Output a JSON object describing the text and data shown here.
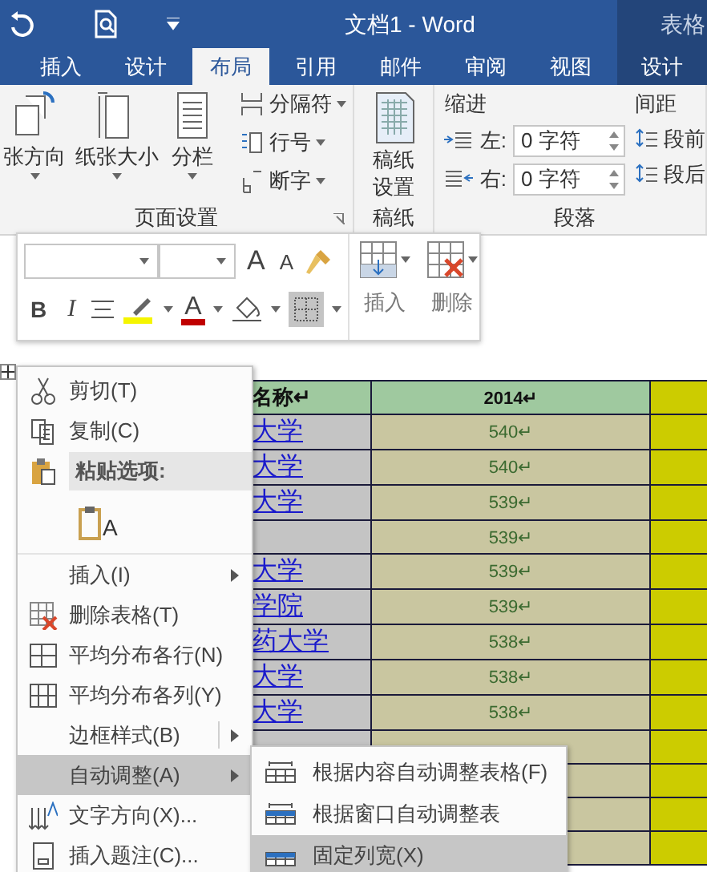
{
  "title_bar": {
    "title": "文档1 - Word",
    "context_group": "表格"
  },
  "tabs": [
    {
      "label": "插入",
      "selected": false,
      "kind": "normal"
    },
    {
      "label": "设计",
      "selected": false,
      "kind": "normal"
    },
    {
      "label": "布局",
      "selected": true,
      "kind": "normal"
    },
    {
      "label": "引用",
      "selected": false,
      "kind": "normal"
    },
    {
      "label": "邮件",
      "selected": false,
      "kind": "normal"
    },
    {
      "label": "审阅",
      "selected": false,
      "kind": "normal"
    },
    {
      "label": "视图",
      "selected": false,
      "kind": "normal"
    },
    {
      "label": "设计",
      "selected": false,
      "kind": "context"
    }
  ],
  "ribbon": {
    "page_setup": {
      "label": "页面设置",
      "large_buttons": [
        "张方向",
        "纸张大小",
        "分栏"
      ],
      "small_buttons": [
        "分隔符",
        "行号",
        "断字"
      ]
    },
    "manuscript": {
      "label": "稿纸",
      "button": "稿纸设置"
    },
    "paragraph": {
      "label": "段落",
      "indent_label": "缩进",
      "left_label": "左:",
      "left_value": "0 字符",
      "right_label": "右:",
      "right_value": "0 字符",
      "spacing_label": "间距",
      "before_label": "段前",
      "after_label": "段后"
    }
  },
  "mini_toolbar": {
    "grow_font": "A",
    "shrink_font": "A",
    "bold": "B",
    "italic": "I",
    "font_color": "A",
    "borders_selected": true,
    "insert_label": "插入",
    "delete_label": "删除"
  },
  "table": {
    "columns": [
      "名称↵",
      "2014↵"
    ],
    "rows": [
      {
        "name": "大学",
        "score": "540↵"
      },
      {
        "name": "大学",
        "score": "540↵"
      },
      {
        "name": "大学",
        "score": "539↵"
      },
      {
        "score": "539↵"
      },
      {
        "name": "大学",
        "score": "539↵"
      },
      {
        "name": "学院",
        "score": "539↵"
      },
      {
        "name": "药大学",
        "score": "538↵"
      },
      {
        "name": "大学",
        "score": "538↵"
      },
      {
        "name": "大学",
        "score": "538↵"
      },
      {},
      {},
      {},
      {}
    ]
  },
  "context_menu": {
    "items": [
      {
        "kind": "item",
        "label": "剪切(T)",
        "submenu": false,
        "selected": false
      },
      {
        "kind": "item",
        "label": "复制(C)",
        "submenu": false,
        "selected": false
      },
      {
        "kind": "header",
        "label": "粘贴选项:"
      },
      {
        "kind": "paste",
        "glyph": "A"
      },
      {
        "kind": "item",
        "label": "插入(I)",
        "submenu": true,
        "selected": false
      },
      {
        "kind": "item",
        "label": "删除表格(T)",
        "submenu": false,
        "selected": false
      },
      {
        "kind": "item",
        "label": "平均分布各行(N)",
        "submenu": false,
        "selected": false
      },
      {
        "kind": "item",
        "label": "平均分布各列(Y)",
        "submenu": false,
        "selected": false
      },
      {
        "kind": "item",
        "label": "边框样式(B)",
        "submenu": true,
        "selected": false
      },
      {
        "kind": "item",
        "label": "自动调整(A)",
        "submenu": true,
        "selected": true
      },
      {
        "kind": "item",
        "label": "文字方向(X)...",
        "submenu": false,
        "selected": false
      },
      {
        "kind": "item",
        "label": "插入题注(C)...",
        "submenu": false,
        "selected": false
      }
    ]
  },
  "submenu": {
    "items": [
      {
        "label": "根据内容自动调整表格(F)",
        "selected": false
      },
      {
        "label": "根据窗口自动调整表",
        "selected": false
      },
      {
        "label": "固定列宽(X)",
        "selected": true
      }
    ]
  }
}
